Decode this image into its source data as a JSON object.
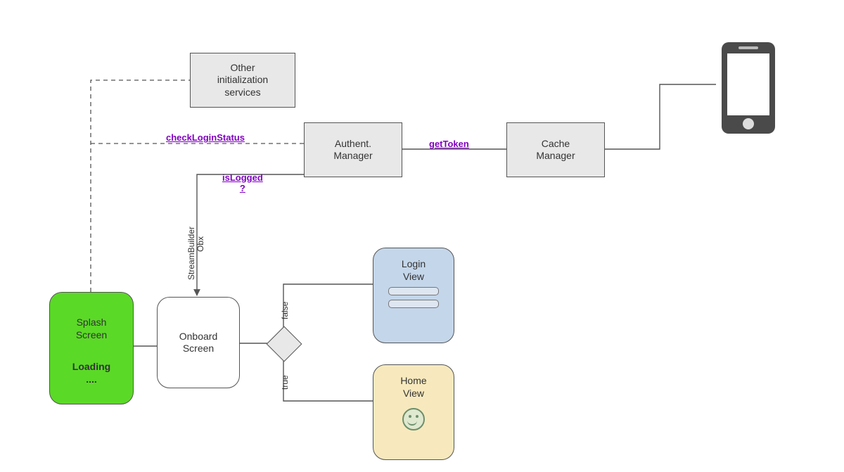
{
  "nodes": {
    "splash": {
      "title": "Splash\nScreen",
      "loading": "Loading",
      "dots": "...."
    },
    "onboard": {
      "title": "Onboard\nScreen"
    },
    "other_init": {
      "title": "Other\ninitialization\nservices"
    },
    "auth_manager": {
      "title": "Authent.\nManager"
    },
    "cache_manager": {
      "title": "Cache\nManager"
    },
    "login_view": {
      "title": "Login\nView"
    },
    "home_view": {
      "title": "Home\nView"
    }
  },
  "edge_labels": {
    "check_login_status": "checkLoginStatus",
    "get_token": "getToken",
    "is_logged": "isLogged\n?",
    "stream_builder": "StreamBuilder",
    "obx": "Obx",
    "branch_false": "false",
    "branch_true": "true"
  },
  "colors": {
    "gray_box": "#e8e8e8",
    "splash": "#5bd927",
    "login_view": "#c4d6ea",
    "home_view": "#f7e9bd",
    "edge_label": "#8000c0"
  }
}
